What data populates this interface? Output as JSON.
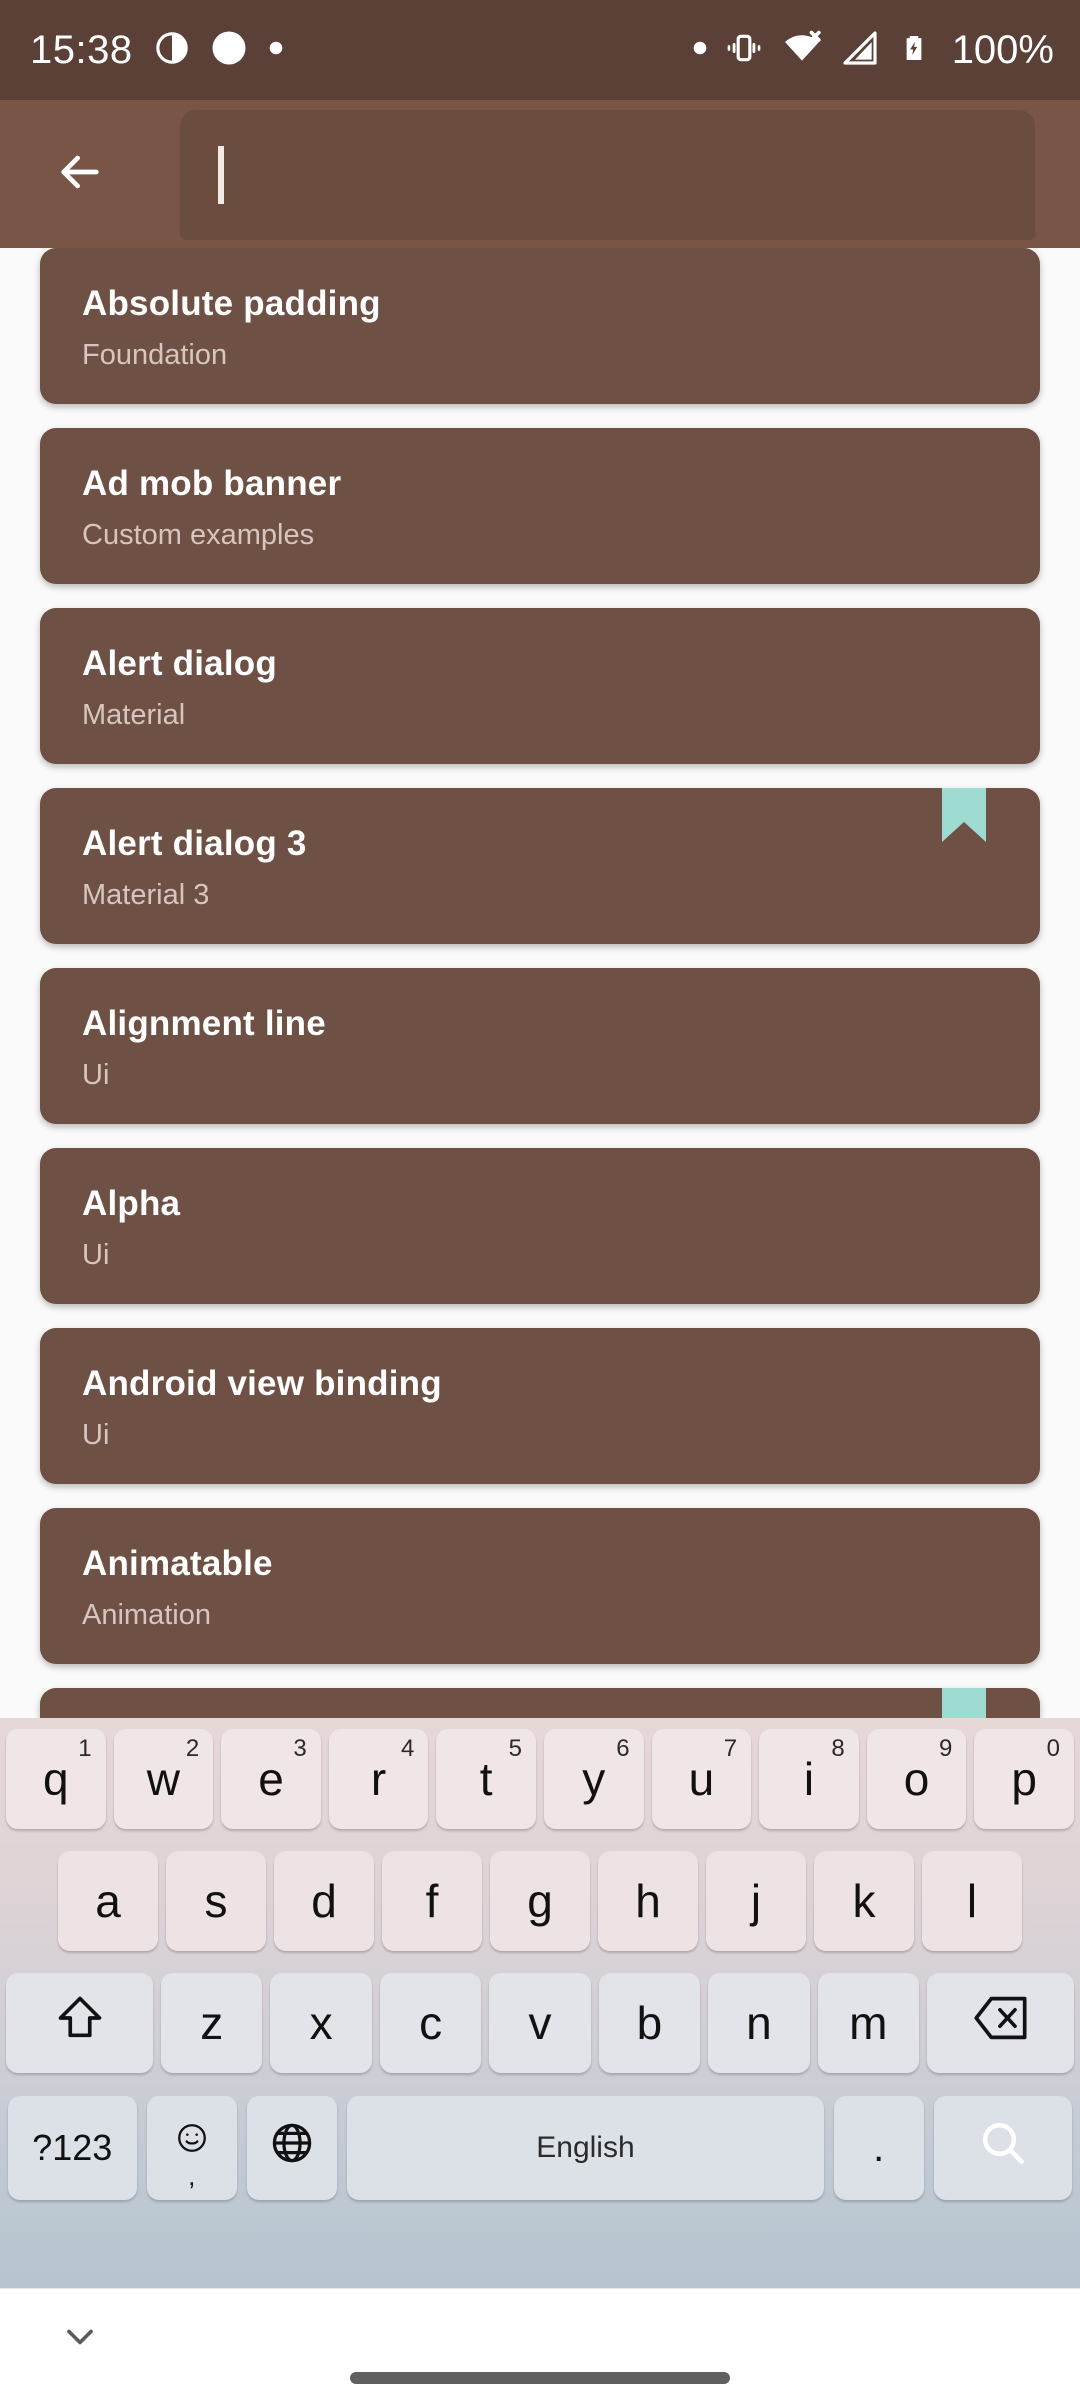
{
  "statusbar": {
    "time": "15:38",
    "battery_percent": "100%",
    "left_icons": [
      "contrast-dot-icon",
      "circle-notification-icon",
      "small-dot-icon"
    ],
    "right_icons": [
      "small-dot-icon",
      "vibrate-icon",
      "wifi-off-icon",
      "signal-off-icon",
      "battery-charging-icon"
    ],
    "background": "#5B4037",
    "foreground": "#FFFFFF"
  },
  "appbar": {
    "back_label": "Back",
    "background": "#795548",
    "search": {
      "value": "",
      "placeholder": ""
    }
  },
  "list": {
    "card_background": "#6E5044",
    "bookmark_color": "#9EDBD0",
    "items": [
      {
        "title": "Absolute padding",
        "subtitle": "Foundation",
        "bookmarked": false
      },
      {
        "title": "Ad mob banner",
        "subtitle": "Custom examples",
        "bookmarked": false
      },
      {
        "title": "Alert dialog",
        "subtitle": "Material",
        "bookmarked": false
      },
      {
        "title": "Alert dialog 3",
        "subtitle": "Material 3",
        "bookmarked": true
      },
      {
        "title": "Alignment line",
        "subtitle": "Ui",
        "bookmarked": false
      },
      {
        "title": "Alpha",
        "subtitle": "Ui",
        "bookmarked": false
      },
      {
        "title": "Android view binding",
        "subtitle": "Ui",
        "bookmarked": false
      },
      {
        "title": "Animatable",
        "subtitle": "Animation",
        "bookmarked": false
      },
      {
        "title": "",
        "subtitle": "",
        "bookmarked": true
      }
    ]
  },
  "keyboard": {
    "language": "English",
    "enter_icon": "search-icon",
    "enter_color": "#C47BA5",
    "row1": [
      {
        "key": "q",
        "sup": "1"
      },
      {
        "key": "w",
        "sup": "2"
      },
      {
        "key": "e",
        "sup": "3"
      },
      {
        "key": "r",
        "sup": "4"
      },
      {
        "key": "t",
        "sup": "5"
      },
      {
        "key": "y",
        "sup": "6"
      },
      {
        "key": "u",
        "sup": "7"
      },
      {
        "key": "i",
        "sup": "8"
      },
      {
        "key": "o",
        "sup": "9"
      },
      {
        "key": "p",
        "sup": "0"
      }
    ],
    "row2": [
      "a",
      "s",
      "d",
      "f",
      "g",
      "h",
      "j",
      "k",
      "l"
    ],
    "row3": [
      "z",
      "x",
      "c",
      "v",
      "b",
      "n",
      "m"
    ],
    "shift_label": "shift-icon",
    "backspace_label": "backspace-icon",
    "numeric_label": "?123",
    "emoji_comma": ",",
    "globe_label": "globe-icon",
    "period_label": "."
  },
  "navbar": {
    "hide_keyboard_icon": "chevron-down-icon"
  }
}
